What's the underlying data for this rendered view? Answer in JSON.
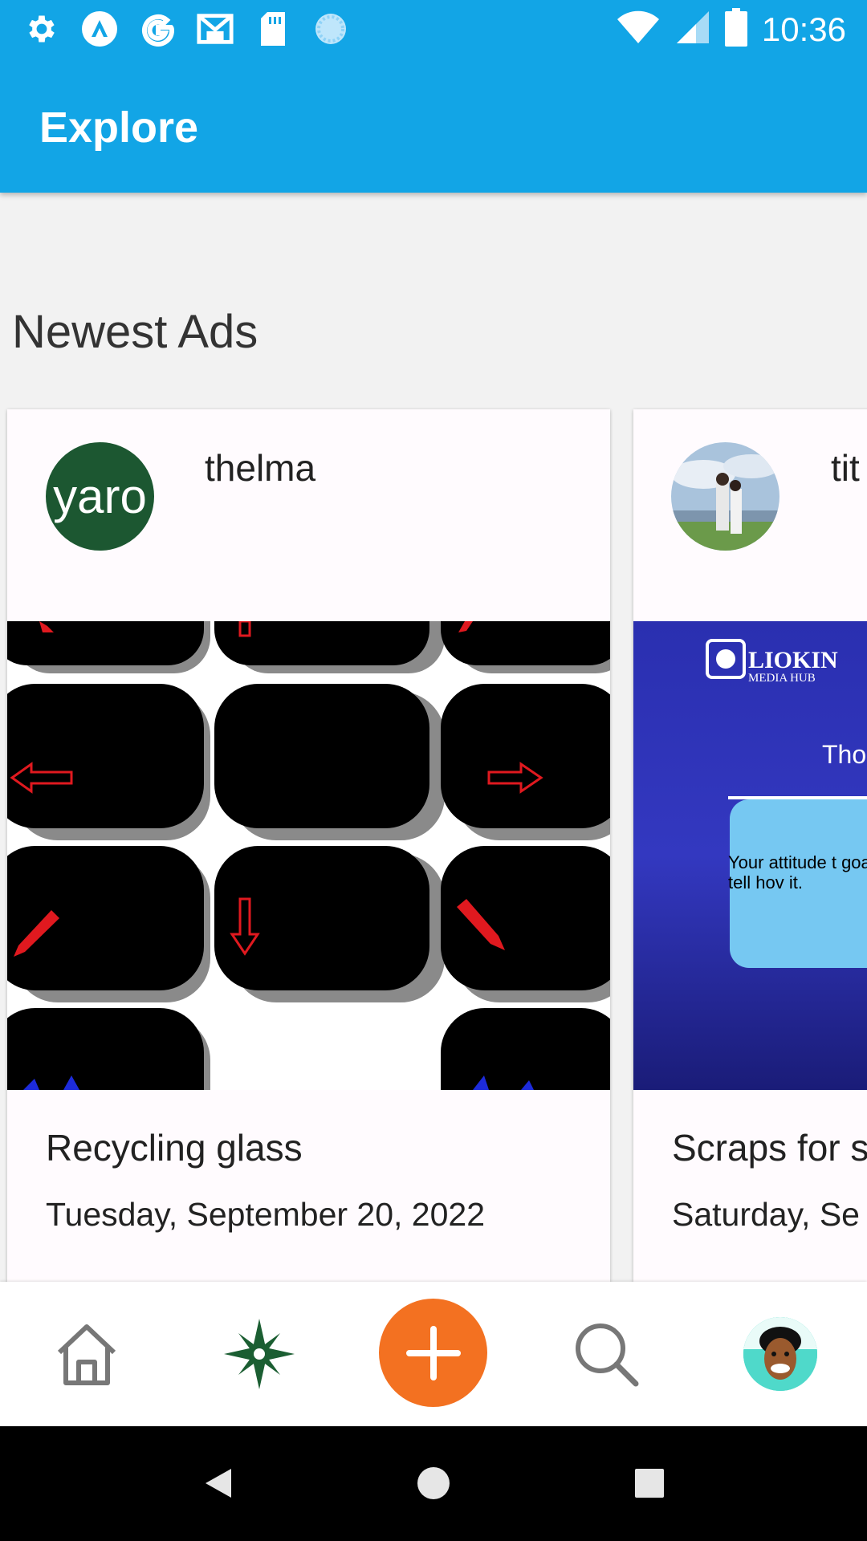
{
  "status_bar": {
    "time": "10:36",
    "left_icons": [
      "gear-icon",
      "vpn-icon",
      "google-icon",
      "gmail-icon",
      "sd-card-icon",
      "sync-icon"
    ],
    "right_icons": [
      "wifi-icon",
      "signal-icon",
      "battery-icon"
    ]
  },
  "app_bar": {
    "title": "Explore",
    "color": "#12a5e6"
  },
  "section": {
    "title": "Newest Ads"
  },
  "ads": [
    {
      "avatar_text": "yaro",
      "user": "thelma",
      "image": "keyboard-arrow-keys-image",
      "title": "Recycling glass",
      "date": "Tuesday, September 20, 2022"
    },
    {
      "avatar": "couple-photo-avatar",
      "user": "tit",
      "image_brand_line1": "LIOKIN",
      "image_brand_line2": "MEDIA HUB",
      "image_heading": "Tho",
      "image_quote": "Your attitude t goal will tell hov it.",
      "title": "Scraps for s",
      "date": "Saturday, Se"
    }
  ],
  "bottom_nav": {
    "items": [
      "home-icon",
      "compass-icon",
      "add-icon",
      "search-icon",
      "profile-avatar"
    ],
    "fab_color": "#f37121"
  },
  "system_nav": [
    "back-icon",
    "home-circle-icon",
    "recents-icon"
  ]
}
